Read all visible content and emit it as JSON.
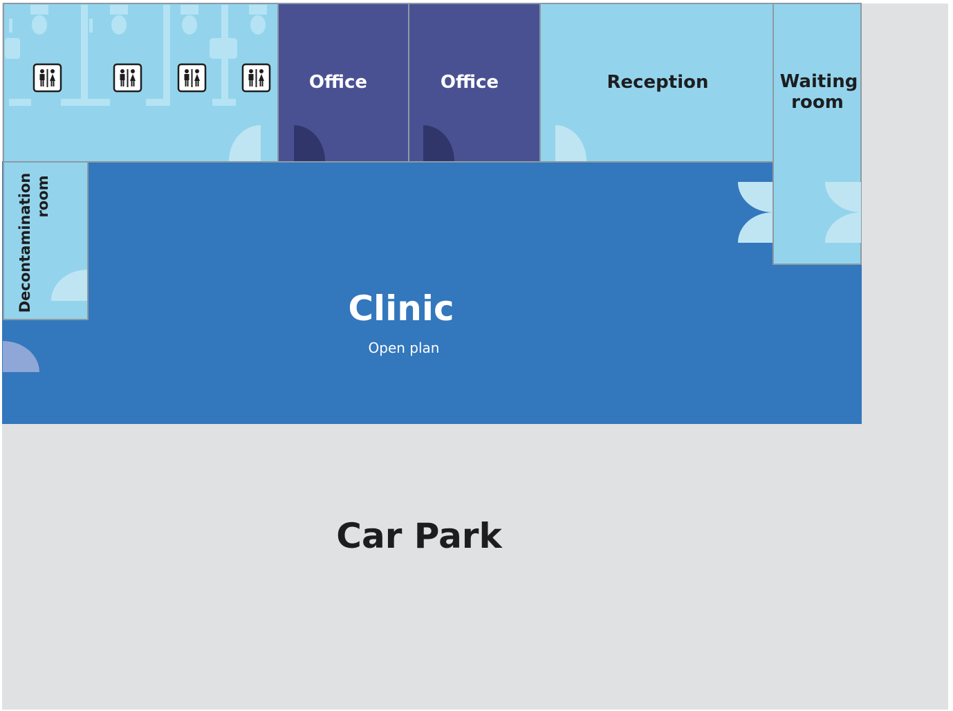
{
  "rooms": {
    "office_1": "Office",
    "office_2": "Office",
    "reception": "Reception",
    "waiting_line1": "Waiting",
    "waiting_line2": "room",
    "decon_line1": "Decontamination",
    "decon_line2": "room",
    "clinic": "Clinic",
    "clinic_sub": "Open plan",
    "car_park": "Car Park"
  },
  "icons": {
    "toilet": "toilet-icon",
    "door": "door-swing-icon"
  },
  "colors": {
    "light_room": "#93d4ec",
    "office": "#4a5193",
    "clinic": "#3377bd",
    "car_park": "#e0e1e3",
    "door_light": "#bfe5f3",
    "door_dark": "#30366a",
    "door_exit": "#8ea7d6",
    "wall": "#8d9aa3",
    "fixture": "#b5e3f4"
  }
}
